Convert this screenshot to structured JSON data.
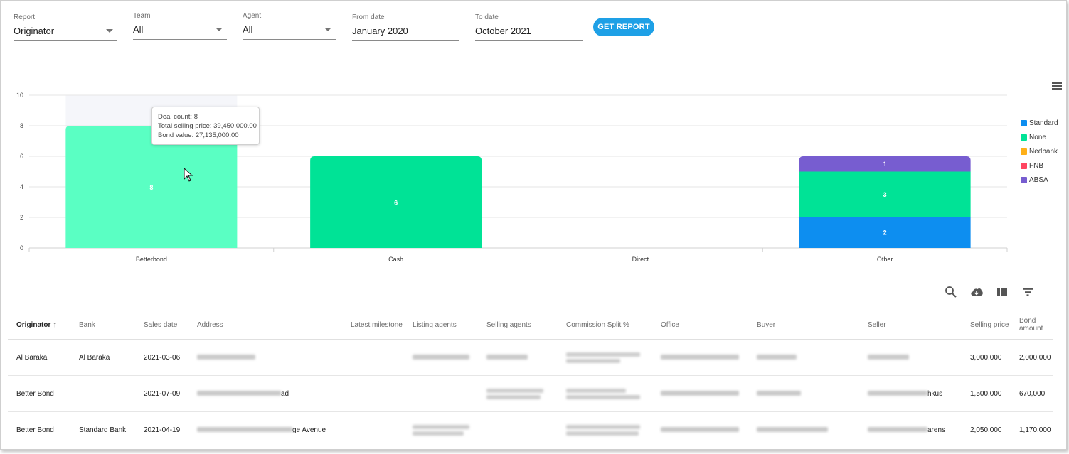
{
  "filters": {
    "report": {
      "label": "Report",
      "value": "Originator"
    },
    "team": {
      "label": "Team",
      "value": "All"
    },
    "agent": {
      "label": "Agent",
      "value": "All"
    },
    "from_date": {
      "label": "From date",
      "value": "January 2020"
    },
    "to_date": {
      "label": "To date",
      "value": "October 2021"
    },
    "get_report_label": "GET REPORT"
  },
  "tooltip": {
    "deal_count": "Deal count: 8",
    "total_selling_price": "Total selling price: 39,450,000.00",
    "bond_value": "Bond value: 27,135,000.00"
  },
  "chart_data": {
    "type": "bar",
    "stacked": true,
    "categories": [
      "Betterbond",
      "Cash",
      "Direct",
      "Other"
    ],
    "ylim": [
      0,
      10
    ],
    "yticks": [
      0,
      2,
      4,
      6,
      8,
      10
    ],
    "legend_position": "right",
    "grid": true,
    "series": [
      {
        "name": "Standard",
        "color": "#0d8ef0",
        "values": [
          0,
          0,
          0,
          2
        ]
      },
      {
        "name": "None",
        "color": "#00e396",
        "values": [
          8,
          6,
          0,
          3
        ]
      },
      {
        "name": "Nedbank",
        "color": "#feb019",
        "values": [
          0,
          0,
          0,
          0
        ]
      },
      {
        "name": "FNB",
        "color": "#ff4560",
        "values": [
          0,
          0,
          0,
          0
        ]
      },
      {
        "name": "ABSA",
        "color": "#775dd0",
        "values": [
          0,
          0,
          0,
          1
        ]
      }
    ],
    "highlight_color": "#5affc3",
    "highlighted_category": 0
  },
  "table": {
    "columns": [
      "Originator",
      "Bank",
      "Sales date",
      "Address",
      "Latest milestone",
      "Listing agents",
      "Selling agents",
      "Commission Split %",
      "Office",
      "Buyer",
      "Seller",
      "Selling price",
      "Bond amount"
    ],
    "rows": [
      {
        "originator": "Al Baraka",
        "bank": "Al Baraka",
        "sales_date": "2021-03-06",
        "address_tail": "",
        "seller_tail": "",
        "selling_price": "3,000,000",
        "bond_amount": "2,000,000"
      },
      {
        "originator": "Better Bond",
        "bank": "",
        "sales_date": "2021-07-09",
        "address_tail": "ad",
        "seller_tail": "hkus",
        "selling_price": "1,500,000",
        "bond_amount": "670,000"
      },
      {
        "originator": "Better Bond",
        "bank": "Standard Bank",
        "sales_date": "2021-04-19",
        "address_tail": "ge Avenue",
        "seller_tail": "arens",
        "selling_price": "2,050,000",
        "bond_amount": "1,170,000"
      }
    ]
  }
}
